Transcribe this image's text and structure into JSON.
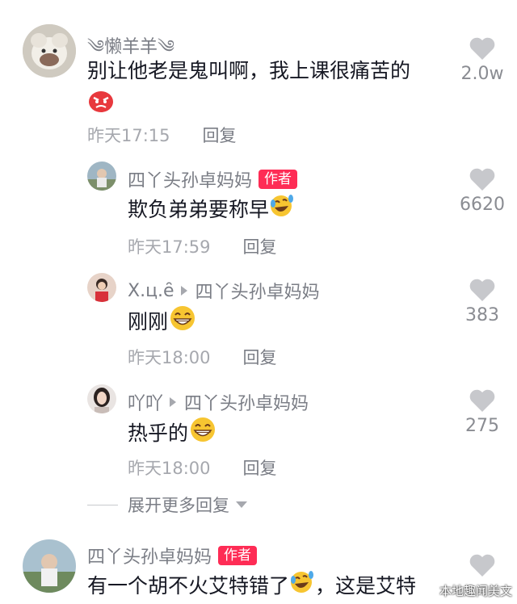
{
  "comments": [
    {
      "name": "༄懒羊羊༄",
      "text": "别让他老是鬼叫啊，我上课很痛苦的",
      "time": "昨天17:15",
      "reply_label": "回复",
      "likes": "2.0w",
      "emoji": "angry-face"
    },
    {
      "name": "四丫头孙卓妈妈",
      "badge": "作者",
      "text": "欺负弟弟要称早",
      "time": "昨天17:59",
      "reply_label": "回复",
      "likes": "6620",
      "emoji": "rolling-laugh-face"
    },
    {
      "name": "X.ц.ȇ",
      "reply_to": "四丫头孙卓妈妈",
      "text": "刚刚",
      "time": "昨天18:00",
      "reply_label": "回复",
      "likes": "383",
      "emoji": "grinning-face"
    },
    {
      "name": "吖吖",
      "reply_to": "四丫头孙卓妈妈",
      "text": "热乎的",
      "time": "昨天18:00",
      "reply_label": "回复",
      "likes": "275",
      "emoji": "grinning-face"
    },
    {
      "name": "四丫头孙卓妈妈",
      "badge": "作者",
      "text": "有一个胡不火艾特错了",
      "text_after": "，这是艾特",
      "emoji": "rolling-laugh-face"
    }
  ],
  "expand_label": "展开更多回复",
  "watermark": "本地趣闻美文"
}
